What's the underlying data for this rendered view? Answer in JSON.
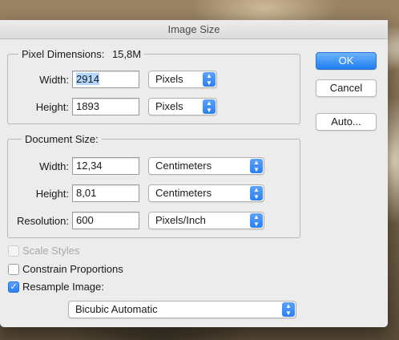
{
  "window": {
    "title": "Image Size"
  },
  "pixel_dimensions": {
    "legend": "Pixel Dimensions:",
    "size": "15,8M",
    "width_label": "Width:",
    "width_value": "2914",
    "width_unit": "Pixels",
    "height_label": "Height:",
    "height_value": "1893",
    "height_unit": "Pixels"
  },
  "document_size": {
    "legend": "Document Size:",
    "width_label": "Width:",
    "width_value": "12,34",
    "width_unit": "Centimeters",
    "height_label": "Height:",
    "height_value": "8,01",
    "height_unit": "Centimeters",
    "resolution_label": "Resolution:",
    "resolution_value": "600",
    "resolution_unit": "Pixels/Inch"
  },
  "options": {
    "scale_styles": {
      "label": "Scale Styles",
      "checked": false,
      "enabled": false
    },
    "constrain_proportions": {
      "label": "Constrain Proportions",
      "checked": false
    },
    "resample_image": {
      "label": "Resample Image:",
      "checked": true
    },
    "resample_method": "Bicubic Automatic"
  },
  "buttons": {
    "ok": "OK",
    "cancel": "Cancel",
    "auto": "Auto..."
  },
  "colors": {
    "accent": "#2c7ef3",
    "selection": "#b3d7ff",
    "dialog_bg": "#ececec"
  }
}
